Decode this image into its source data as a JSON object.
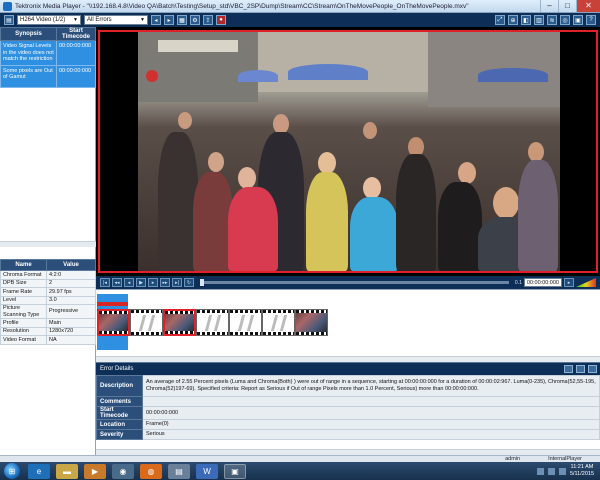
{
  "window": {
    "title": "Tektronix Media Player - \"\\\\192.168.4.8\\Video QA\\Batch\\Testing\\Setup_std\\VBC_2SP\\Dump\\Stream\\CC\\Stream\\OnTheMovePeople_OnTheMovePeople.mxv\"",
    "minimize": "–",
    "maximize": "□",
    "close": "✕"
  },
  "toolbar": {
    "stream_select": "H264 Video (1/2)",
    "filter_select": "All Errors"
  },
  "synopsis": {
    "headers": [
      "Synopsis",
      "Start Timecode"
    ],
    "rows": [
      {
        "synopsis": "Video Signal Levels in the video does not match the restriction",
        "timecode": "00:00:00:000"
      },
      {
        "synopsis": "Some pixels are Out of Gamut",
        "timecode": "00:00:00:000"
      }
    ]
  },
  "properties": {
    "headers": [
      "Name",
      "Value"
    ],
    "rows": [
      {
        "name": "Chroma Format",
        "value": "4:2:0",
        "tall": false
      },
      {
        "name": "DPB Size",
        "value": "2",
        "tall": false
      },
      {
        "name": "Frame Rate",
        "value": "29.97 fps",
        "tall": false
      },
      {
        "name": "Level",
        "value": "3.0",
        "tall": false
      },
      {
        "name": "Picture Scanning Type",
        "value": "Progressive",
        "tall": true
      },
      {
        "name": "Profile",
        "value": "Main",
        "tall": false
      },
      {
        "name": "Resolution",
        "value": "1280x720",
        "tall": false
      },
      {
        "name": "Video Format",
        "value": "NA",
        "tall": false
      }
    ]
  },
  "transport": {
    "label": "0.1",
    "timecode": "00:00:00:000"
  },
  "timeline": {
    "thumbs": [
      "img-err",
      "gap",
      "img-err",
      "gap",
      "gap",
      "gap",
      "img"
    ]
  },
  "error_details": {
    "title": "Error Details",
    "rows": [
      {
        "label": "Description",
        "value": "An average of 2.55 Percent pixels (Luma and Chroma(Both) ) were out of range in a sequence, starting at 00:00:00:000 for a duration of 00:00:02:967. Luma(0-235), Chroma(52,55-195, Chroma(52)197-69). Specified criteria: Report as Serious if Out of range Pixels more than 1.0 Percent, Serious) more than 00:00:00:000.",
        "kind": "desc"
      },
      {
        "label": "Comments",
        "value": "",
        "kind": "norm"
      },
      {
        "label": "Start Timecode",
        "value": "00:00:00:000",
        "kind": "norm"
      },
      {
        "label": "Location",
        "value": "Frame(0)",
        "kind": "norm"
      },
      {
        "label": "Severity",
        "value": "Serious",
        "kind": "norm"
      }
    ]
  },
  "statusbar": {
    "user": "admin",
    "mode": "InternalPlayer"
  },
  "taskbar": {
    "time": "11:21 AM",
    "date": "5/11/2015"
  },
  "colors": {
    "accent_dark": "#0d2f57",
    "selection_blue": "#2f8fe0",
    "error_red": "#e0202a"
  }
}
